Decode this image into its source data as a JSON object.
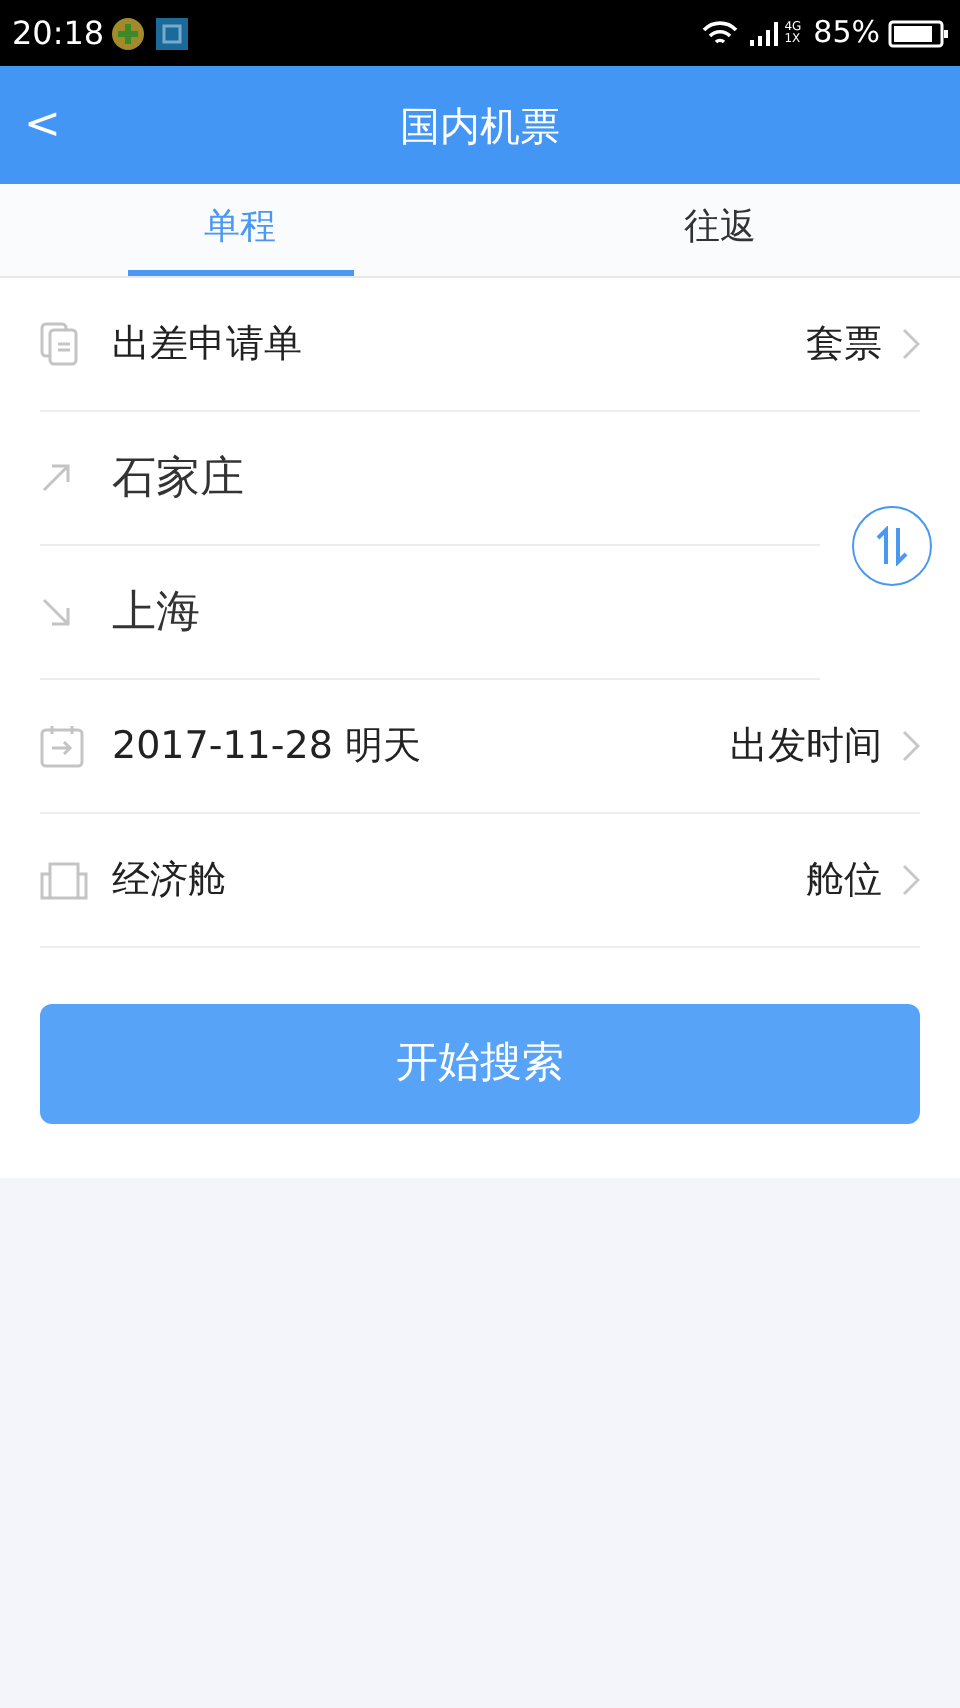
{
  "status_bar": {
    "time": "20:18",
    "network": [
      "4G",
      "1X"
    ],
    "battery": "85%"
  },
  "header": {
    "back": "<",
    "title": "国内机票"
  },
  "tabs": [
    {
      "label": "单程",
      "selected": true
    },
    {
      "label": "往返",
      "selected": false
    }
  ],
  "rows": [
    {
      "kind": "option",
      "label": "出差申请单",
      "value": "套票"
    },
    {
      "kind": "city",
      "label": "石家庄"
    },
    {
      "kind": "city",
      "label": "上海"
    },
    {
      "kind": "option",
      "label": "2017-11-28 明天",
      "value": "出发时间"
    },
    {
      "kind": "option",
      "label": "经济舱",
      "value": "舱位"
    }
  ],
  "search_button": "开始搜索"
}
